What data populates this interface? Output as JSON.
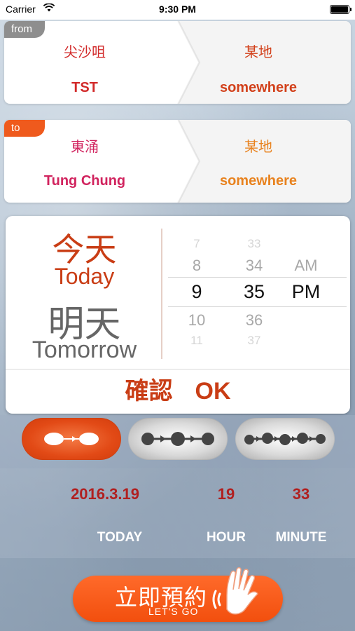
{
  "status_bar": {
    "carrier": "Carrier",
    "time": "9:30 PM",
    "icons": [
      "wifi-icon",
      "battery-icon"
    ]
  },
  "from_card": {
    "tag": "from",
    "start_cn": "尖沙咀",
    "start_en": "TST",
    "dest_cn": "某地",
    "dest_en": "somewhere"
  },
  "to_card": {
    "tag": "to",
    "start_cn": "東涌",
    "start_en": "Tung Chung",
    "dest_cn": "某地",
    "dest_en": "somewhere"
  },
  "picker": {
    "day_options": [
      {
        "cn": "今天",
        "en": "Today",
        "selected": true
      },
      {
        "cn": "明天",
        "en": "Tomorrow",
        "selected": false
      }
    ],
    "hours": [
      "7",
      "8",
      "9",
      "10",
      "11"
    ],
    "minutes": [
      "33",
      "34",
      "35",
      "36",
      "37"
    ],
    "ampm": [
      "AM",
      "PM"
    ],
    "selected_hour": "9",
    "selected_minute": "35",
    "selected_ampm": "PM",
    "confirm_cn": "確認",
    "confirm_en": "OK"
  },
  "stop_options": [
    {
      "stops": 2,
      "active": true
    },
    {
      "stops": 3,
      "active": false
    },
    {
      "stops": 5,
      "active": false
    }
  ],
  "info": {
    "date_value": "2016.3.19",
    "hour_value": "19",
    "minute_value": "33",
    "date_label": "TODAY",
    "hour_label": "HOUR",
    "minute_label": "MINUTE"
  },
  "go_button": {
    "label_cn": "立即預約",
    "label_en": "LET'S GO",
    "icon": "hand-icon"
  },
  "colors": {
    "accent": "#ef5a1d",
    "from_start_text": "#d22a2a",
    "from_dest_text": "#d2401a",
    "to_start_text": "#d1235e",
    "to_dest_text": "#e8821e",
    "day_selected": "#c93d15",
    "day_unselected": "#666666",
    "info_value": "#b11f1f"
  }
}
